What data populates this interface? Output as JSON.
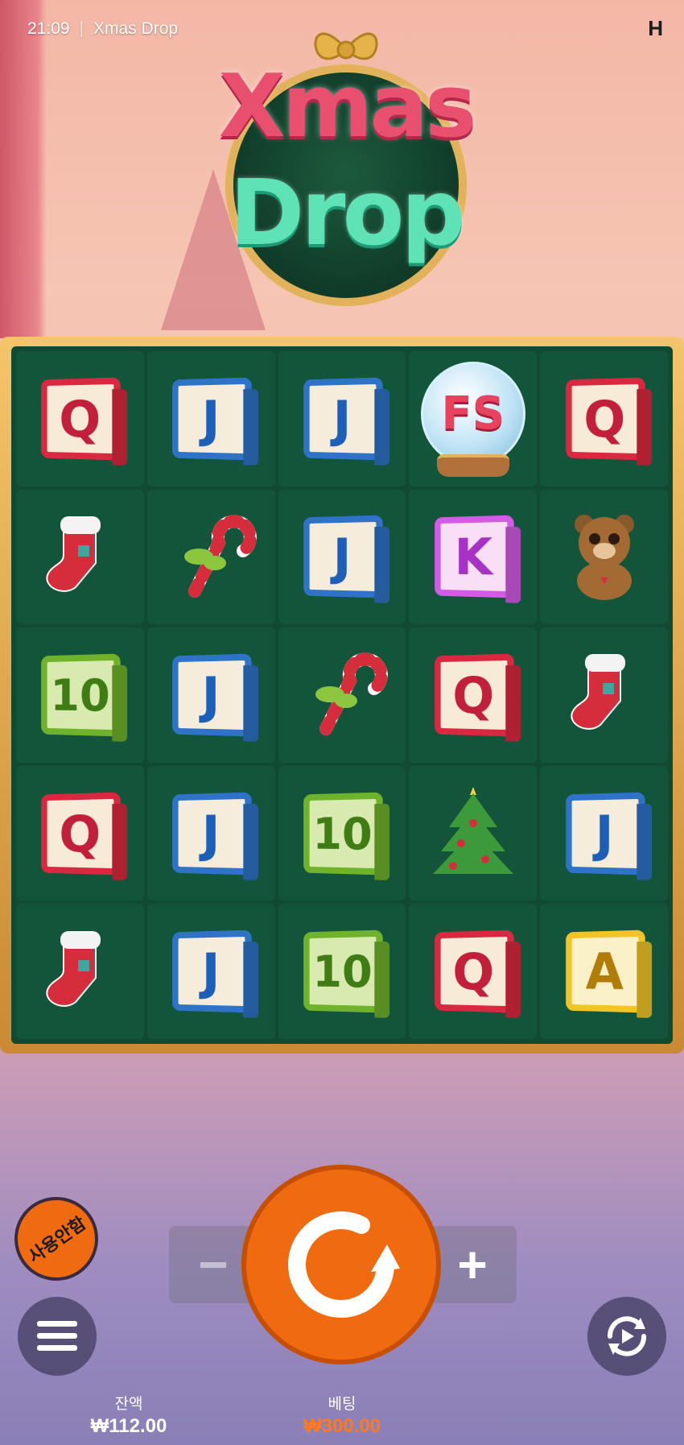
{
  "status_bar": {
    "time": "21:09",
    "title": "Xmas Drop"
  },
  "logo": {
    "line1": "Xmas",
    "line2": "Drop"
  },
  "grid": {
    "rows": [
      [
        {
          "type": "cube-q",
          "label": "Q"
        },
        {
          "type": "cube-j",
          "label": "J"
        },
        {
          "type": "cube-j",
          "label": "J"
        },
        {
          "type": "scatter-globe",
          "label": "FS"
        },
        {
          "type": "cube-q",
          "label": "Q"
        }
      ],
      [
        {
          "type": "stocking",
          "label": ""
        },
        {
          "type": "candy-cane",
          "label": ""
        },
        {
          "type": "cube-j",
          "label": "J"
        },
        {
          "type": "cube-k",
          "label": "K"
        },
        {
          "type": "teddy-bear",
          "label": ""
        }
      ],
      [
        {
          "type": "cube-10",
          "label": "10"
        },
        {
          "type": "cube-j",
          "label": "J"
        },
        {
          "type": "candy-cane",
          "label": ""
        },
        {
          "type": "cube-q",
          "label": "Q"
        },
        {
          "type": "stocking",
          "label": ""
        }
      ],
      [
        {
          "type": "cube-q",
          "label": "Q"
        },
        {
          "type": "cube-j",
          "label": "J"
        },
        {
          "type": "cube-10",
          "label": "10"
        },
        {
          "type": "xmas-tree",
          "label": ""
        },
        {
          "type": "cube-j",
          "label": "J"
        }
      ],
      [
        {
          "type": "stocking",
          "label": ""
        },
        {
          "type": "cube-j",
          "label": "J"
        },
        {
          "type": "cube-10",
          "label": "10"
        },
        {
          "type": "cube-q",
          "label": "Q"
        },
        {
          "type": "cube-a",
          "label": "A"
        }
      ]
    ]
  },
  "controls": {
    "autoplay_label": "사용안함",
    "minus": "−",
    "plus": "+",
    "balance_label": "잔액",
    "balance_value": "₩112.00",
    "bet_label": "베팅",
    "bet_value": "₩300.00"
  },
  "colors": {
    "spin": "#f06a0f",
    "board": "#0f4a31",
    "frame": "#e2b25a",
    "bet_value": "#ff7a1f"
  }
}
